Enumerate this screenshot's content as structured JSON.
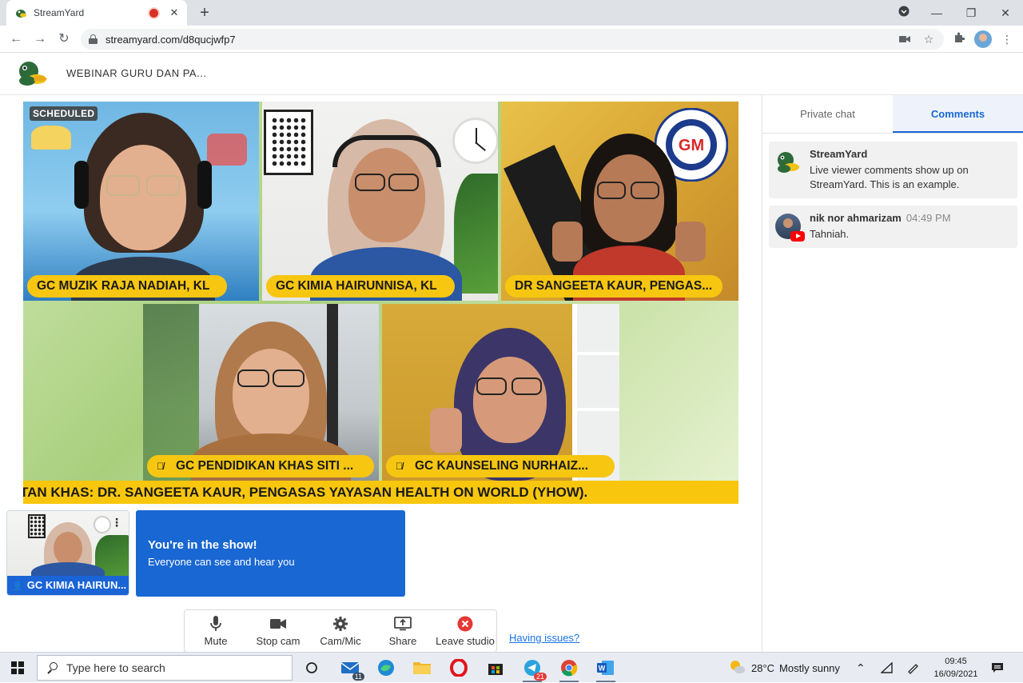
{
  "browser": {
    "tab_title": "StreamYard",
    "url": "streamyard.com/d8qucjwfp7"
  },
  "app": {
    "title": "WEBINAR GURU DAN PA..."
  },
  "stage": {
    "scheduled_badge": "SCHEDULED",
    "participants": [
      {
        "name": "GC MUZIK RAJA NADIAH, KL",
        "muted": false
      },
      {
        "name": "GC KIMIA HAIRUNNISA, KL",
        "muted": false
      },
      {
        "name": "DR SANGEETA KAUR, PENGAS...",
        "muted": false
      },
      {
        "name": "GC PENDIDIKAN KHAS SITI ...",
        "muted": true
      },
      {
        "name": "GC KAUNSELING NURHAIZ...",
        "muted": true
      }
    ],
    "ticker": "TAN KHAS: DR. SANGEETA KAUR, PENGASAS YAYASAN HEALTH ON WORLD (YHOW)."
  },
  "self_view": {
    "label": "GC KIMIA HAIRUN..."
  },
  "notice": {
    "title": "You're in the show!",
    "subtitle": "Everyone can see and hear you"
  },
  "controls": [
    {
      "label": "Mute",
      "icon": "mic-icon"
    },
    {
      "label": "Stop cam",
      "icon": "camera-icon"
    },
    {
      "label": "Cam/Mic",
      "icon": "gear-icon"
    },
    {
      "label": "Share",
      "icon": "screen-share-icon"
    },
    {
      "label": "Leave studio",
      "icon": "leave-icon"
    }
  ],
  "having_issues": "Having issues?",
  "panel": {
    "tabs": [
      "Private chat",
      "Comments"
    ],
    "active_tab": "Comments",
    "comments": [
      {
        "author": "StreamYard",
        "time": "",
        "text": "Live viewer comments show up on StreamYard. This is an example."
      },
      {
        "author": "nik nor ahmarizam",
        "time": "04:49 PM",
        "text": "Tahniah."
      }
    ]
  },
  "taskbar": {
    "search_placeholder": "Type here to search",
    "mail_badge": "11",
    "telegram_badge": "21",
    "weather": "28°C",
    "weather_text": "Mostly sunny",
    "time": "09:45",
    "date": "16/09/2021"
  },
  "colors": {
    "accent": "#1967d2",
    "nametag": "#f6c611",
    "leave": "#e53935"
  }
}
